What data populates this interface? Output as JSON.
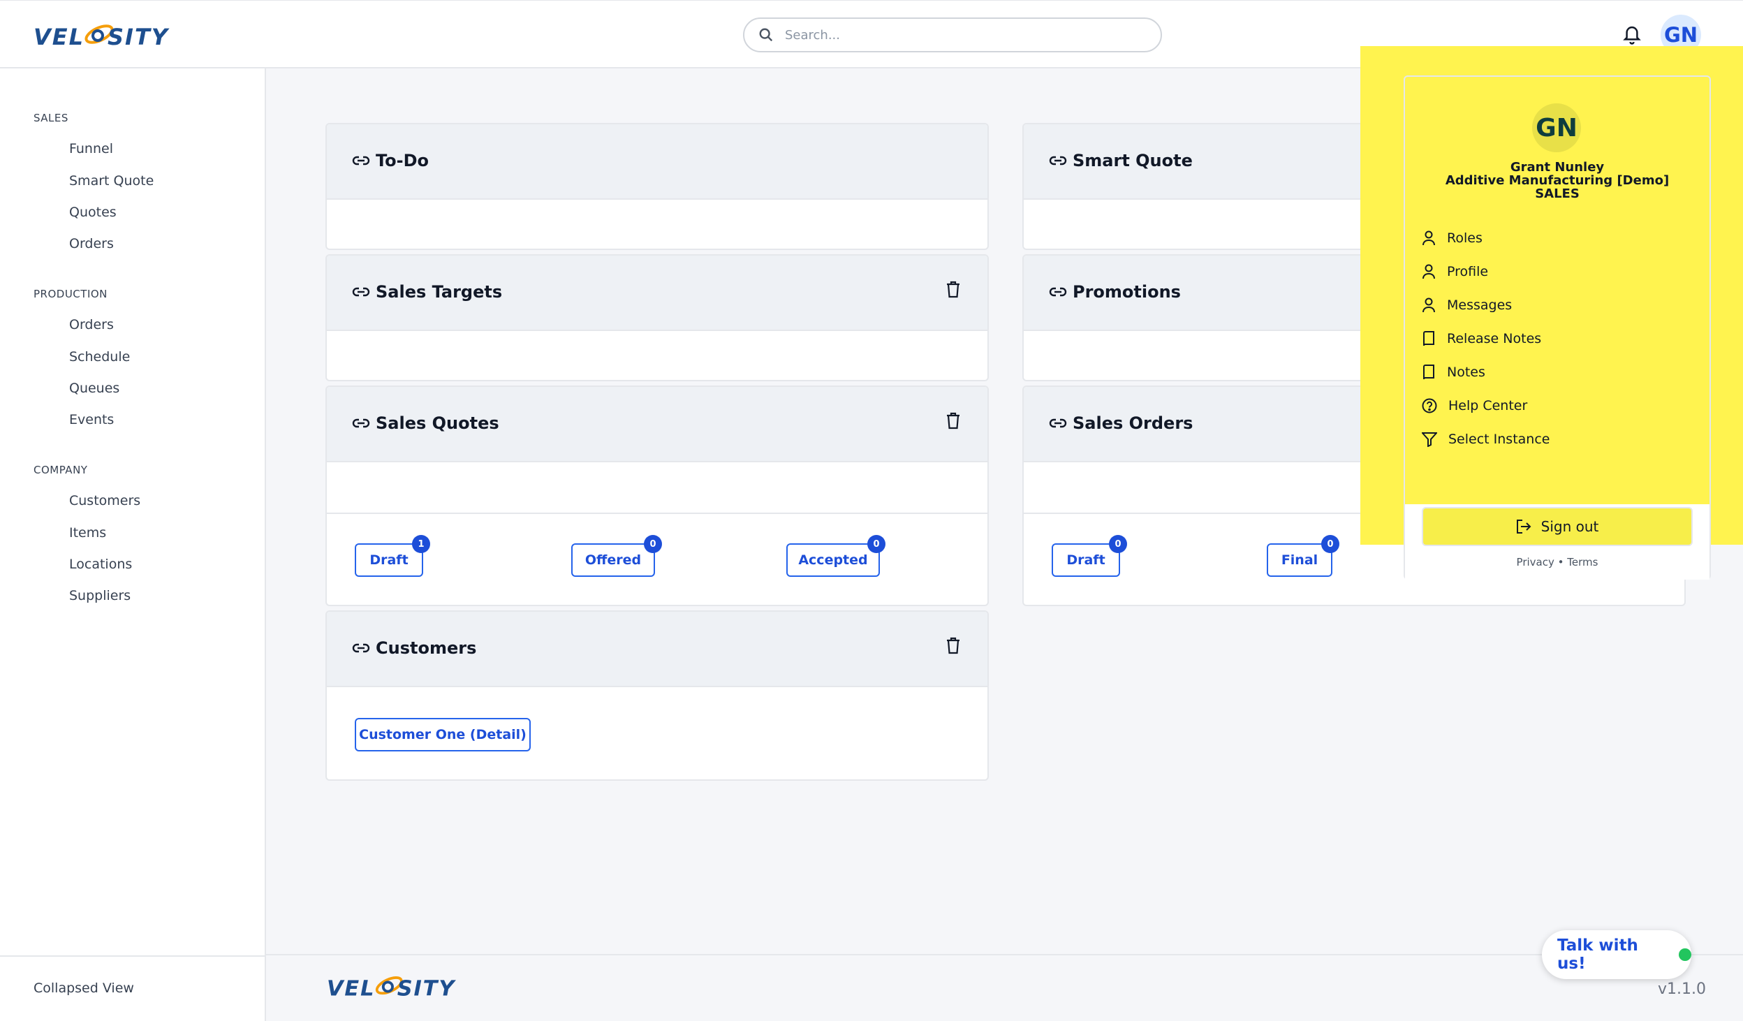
{
  "brand": {
    "name": "VELOSITY",
    "accent": "#1e4f8f",
    "orbit": "#f59e0b"
  },
  "search": {
    "placeholder": "Search..."
  },
  "header": {
    "avatar_initials": "GN"
  },
  "sidebar": {
    "sections": [
      {
        "title": "SALES",
        "items": [
          "Funnel",
          "Smart Quote",
          "Quotes",
          "Orders"
        ]
      },
      {
        "title": "PRODUCTION",
        "items": [
          "Orders",
          "Schedule",
          "Queues",
          "Events"
        ]
      },
      {
        "title": "COMPANY",
        "items": [
          "Customers",
          "Items",
          "Locations",
          "Suppliers"
        ]
      }
    ],
    "collapsed_label": "Collapsed View"
  },
  "cards": {
    "todo": {
      "title": "To-Do"
    },
    "smart_quote": {
      "title": "Smart Quote"
    },
    "sales_targets": {
      "title": "Sales Targets"
    },
    "promotions": {
      "title": "Promotions"
    },
    "sales_quotes": {
      "title": "Sales Quotes",
      "statuses": [
        {
          "label": "Draft",
          "count": "1"
        },
        {
          "label": "Offered",
          "count": "0"
        },
        {
          "label": "Accepted",
          "count": "0"
        }
      ]
    },
    "sales_orders": {
      "title": "Sales Orders",
      "statuses": [
        {
          "label": "Draft",
          "count": "0"
        },
        {
          "label": "Final",
          "count": "0"
        }
      ]
    },
    "customers": {
      "title": "Customers",
      "link_label": "Customer One (Detail)"
    }
  },
  "user_menu": {
    "initials": "GN",
    "name": "Grant Nunley",
    "company": "Additive Manufacturing [Demo]",
    "role": "SALES",
    "items": [
      {
        "label": "Roles",
        "icon": "user-icon"
      },
      {
        "label": "Profile",
        "icon": "user-icon"
      },
      {
        "label": "Messages",
        "icon": "user-icon"
      },
      {
        "label": "Release Notes",
        "icon": "book-icon"
      },
      {
        "label": "Notes",
        "icon": "book-icon"
      },
      {
        "label": "Help Center",
        "icon": "help-circle-icon"
      },
      {
        "label": "Select Instance",
        "icon": "filter-icon"
      }
    ],
    "sign_out_label": "Sign out",
    "privacy_label": "Privacy",
    "terms_label": "Terms",
    "separator": "•"
  },
  "footer": {
    "version": "v1.1.0"
  },
  "chat": {
    "label": "Talk with us!",
    "status_color": "#22c55e"
  },
  "highlight_color": "#fff34f"
}
